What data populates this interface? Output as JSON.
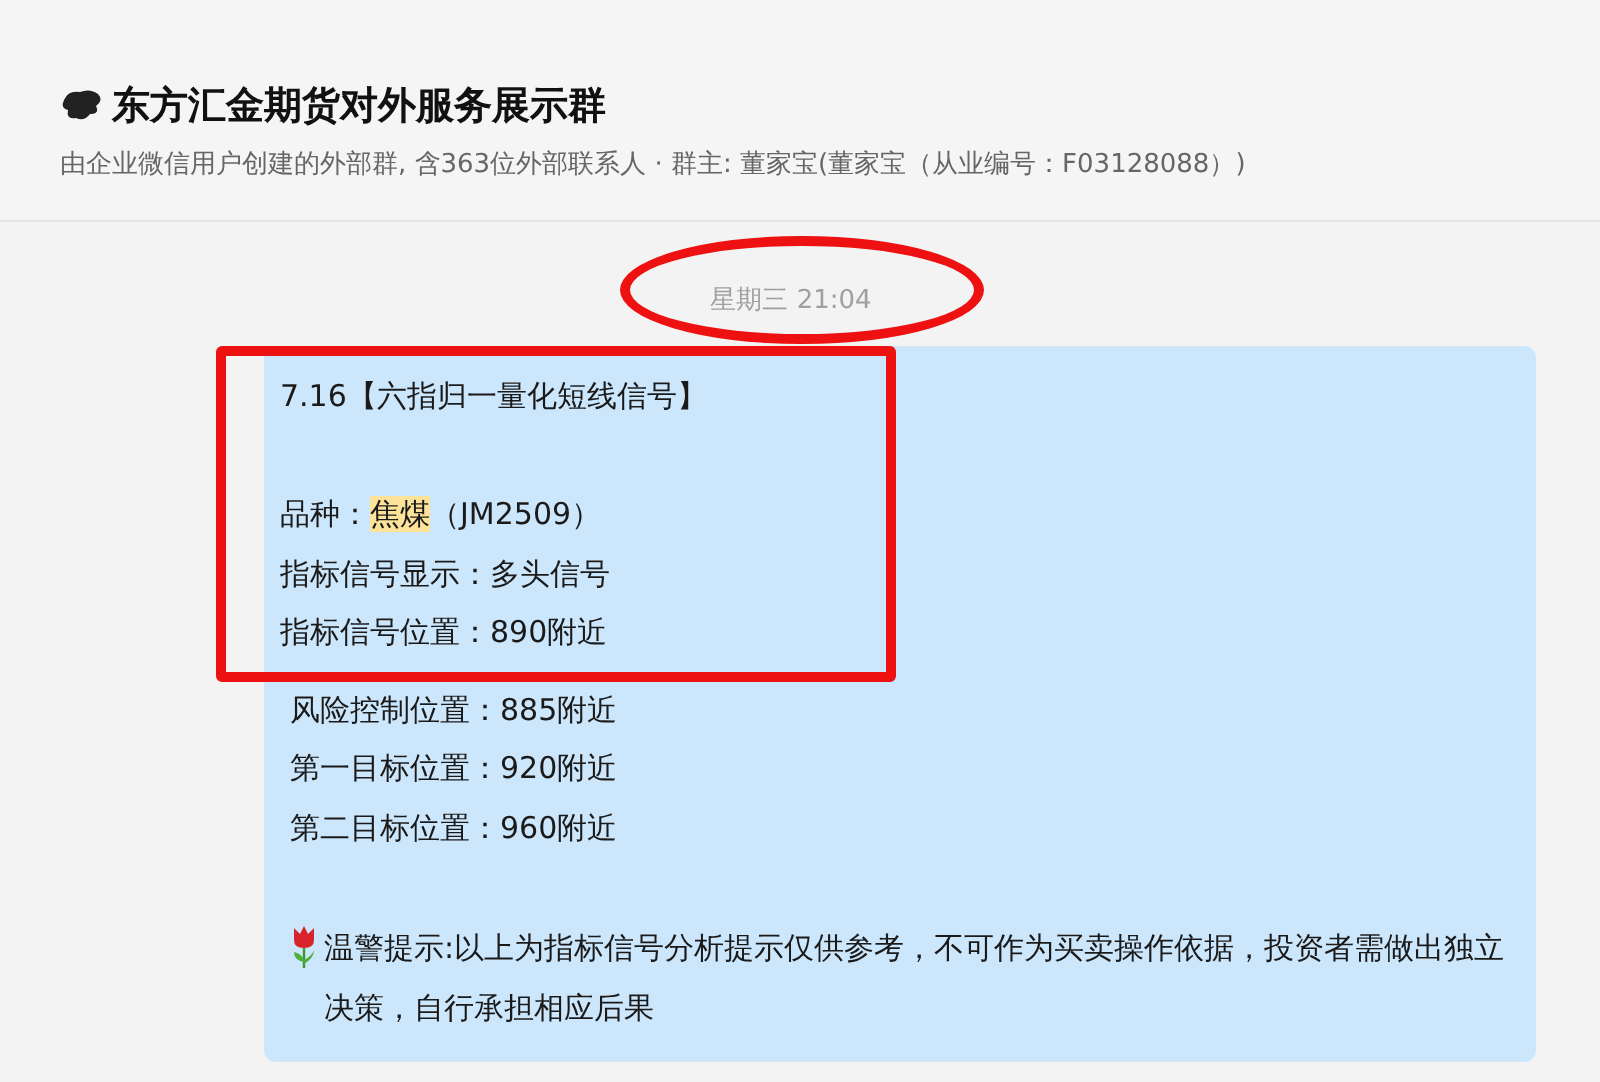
{
  "header": {
    "title": "东方汇金期货对外服务展示群",
    "subtitle": "由企业微信用户创建的外部群, 含363位外部联系人 · 群主: 董家宝(董家宝（从业编号：F03128088）)"
  },
  "time": {
    "text": "星期三 21:04",
    "circled": true
  },
  "message": {
    "title": {
      "text": "7.16【六指归一量化短线信号】",
      "boxed": true
    },
    "fields": [
      {
        "label": "品种：",
        "highlight": "焦煤",
        "rest": "（JM2509）",
        "boxed": true
      },
      {
        "text": "指标信号显示：多头信号",
        "boxed": true
      },
      {
        "text": "指标信号位置：890附近",
        "boxed": true
      },
      {
        "text": "风险控制位置：885附近",
        "boxed": false
      },
      {
        "text": "第一目标位置：920附近",
        "boxed": false
      },
      {
        "text": "第二目标位置：960附近",
        "boxed": false
      }
    ],
    "warning": "温警提示:以上为指标信号分析提示仅供参考，不可作为买卖操作依据，投资者需做出独立决策，自行承担相应后果"
  }
}
